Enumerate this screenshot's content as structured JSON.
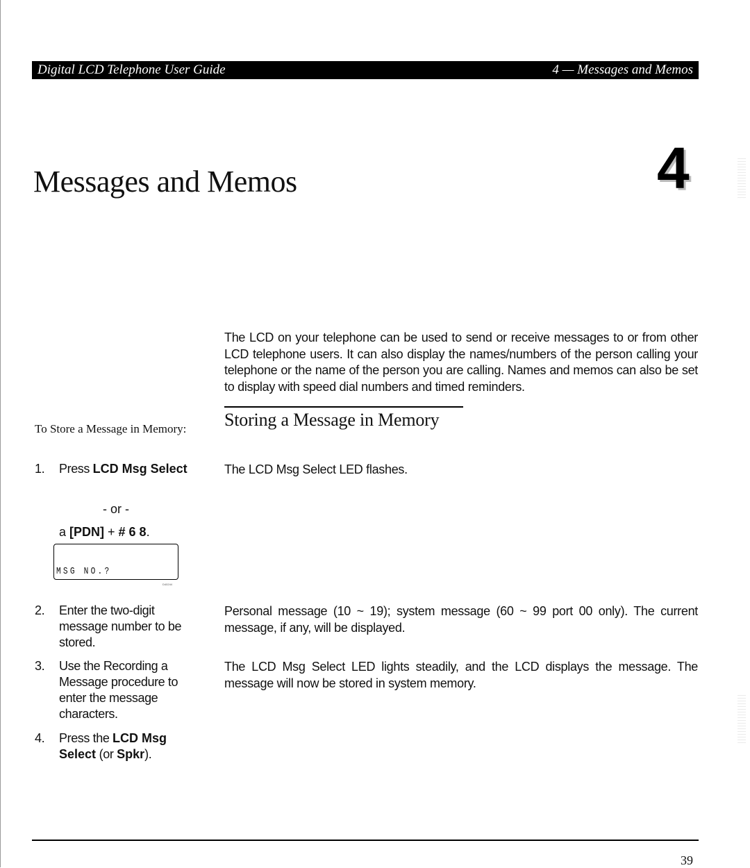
{
  "header": {
    "left": "Digital LCD Telephone User Guide",
    "right": "4 — Messages and Memos"
  },
  "chapter": {
    "title": "Messages and Memos",
    "number": "4"
  },
  "intro": "The LCD on your telephone can be used to send or receive messages to or from other LCD telephone users. It can also display the names/numbers of the person calling your telephone or the name of the person you are calling. Names and memos can also be set to display with speed dial numbers and timed reminders.",
  "section": {
    "title": "Storing a Message in Memory",
    "procedure_title": "To Store a Message in Memory:"
  },
  "steps": [
    {
      "number": "1.",
      "prefix": "Press ",
      "key": "LCD Msg Select",
      "or": "- or -",
      "alt_prefix": "a ",
      "alt_pdn": "[PDN]",
      "alt_plus": " + ",
      "alt_keys": "# 6 8",
      "alt_suffix": ".",
      "result": "The LCD Msg Select LED flashes."
    },
    {
      "number": "2.",
      "text": "Enter the two-digit message number to be stored.",
      "result": "Personal message (10 ~ 19); system message (60 ~ 99 port 00 only). The current message, if any, will be displayed."
    },
    {
      "number": "3.",
      "text": "Use the Recording a Message procedure to enter the message characters.",
      "result": "The LCD Msg Select LED lights steadily, and the LCD displays the message. The message will now be stored in system memory."
    },
    {
      "number": "4.",
      "prefix": "Press the ",
      "key": "LCD Msg Select",
      "mid": " (or ",
      "key2": "Spkr",
      "suffix": ")."
    }
  ],
  "lcd_display": {
    "text": "MSG NO.?",
    "figure_id": "D40244"
  },
  "footer": {
    "page_number": "39"
  }
}
